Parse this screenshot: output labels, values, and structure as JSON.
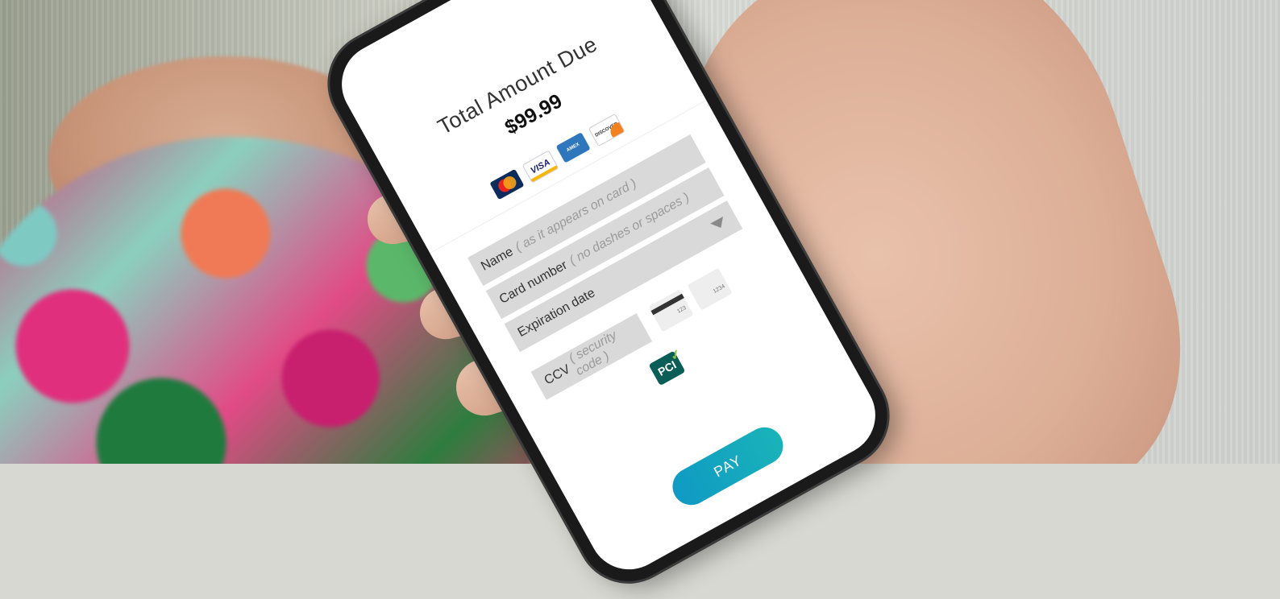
{
  "checkout": {
    "total_label": "Total Amount Due",
    "total_amount": "$99.99",
    "accepted_cards": [
      "mastercard",
      "visa",
      "amex",
      "discover"
    ]
  },
  "form": {
    "name_label": "Name",
    "name_hint": "( as it appears on card )",
    "card_label": "Card number",
    "card_hint": "( no dashes or spaces )",
    "exp_label": "Expiration date",
    "ccv_label": "CCV",
    "ccv_hint": "( security code )",
    "cvv_example_3": "123",
    "cvv_example_4": "1234"
  },
  "badge": {
    "pci_text": "PCI"
  },
  "actions": {
    "pay_label": "PAY"
  },
  "colors": {
    "pay_button": "#14a6bf",
    "field_bg": "#d9d9d9"
  }
}
